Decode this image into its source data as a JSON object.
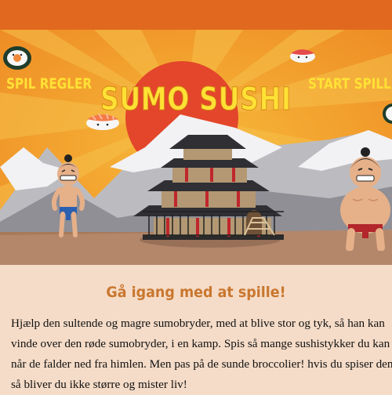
{
  "header": {
    "title": "SUMO SUSHI",
    "nav_rules": "SPIL REGLER",
    "nav_start": "START SPILLE"
  },
  "content": {
    "heading": "Gå igang med at spille!",
    "lines": [
      "Hjælp den sultende og magre sumobryder, med at blive stor og tyk, så han kan",
      "vinde over den røde sumobryder, i en kamp. Spis så mange sushistykker du kan",
      "når de falder ned fra himlen. Men pas på de sunde broccolier! hvis du spiser den",
      "så bliver du ikke større og mister liv!"
    ]
  },
  "colors": {
    "topbar": "#e0691f",
    "sky": "#f0a534",
    "sun": "#e3462a",
    "title_yellow": "#ffe135",
    "heading": "#c9772f",
    "page_bg": "#f5dcc8"
  }
}
